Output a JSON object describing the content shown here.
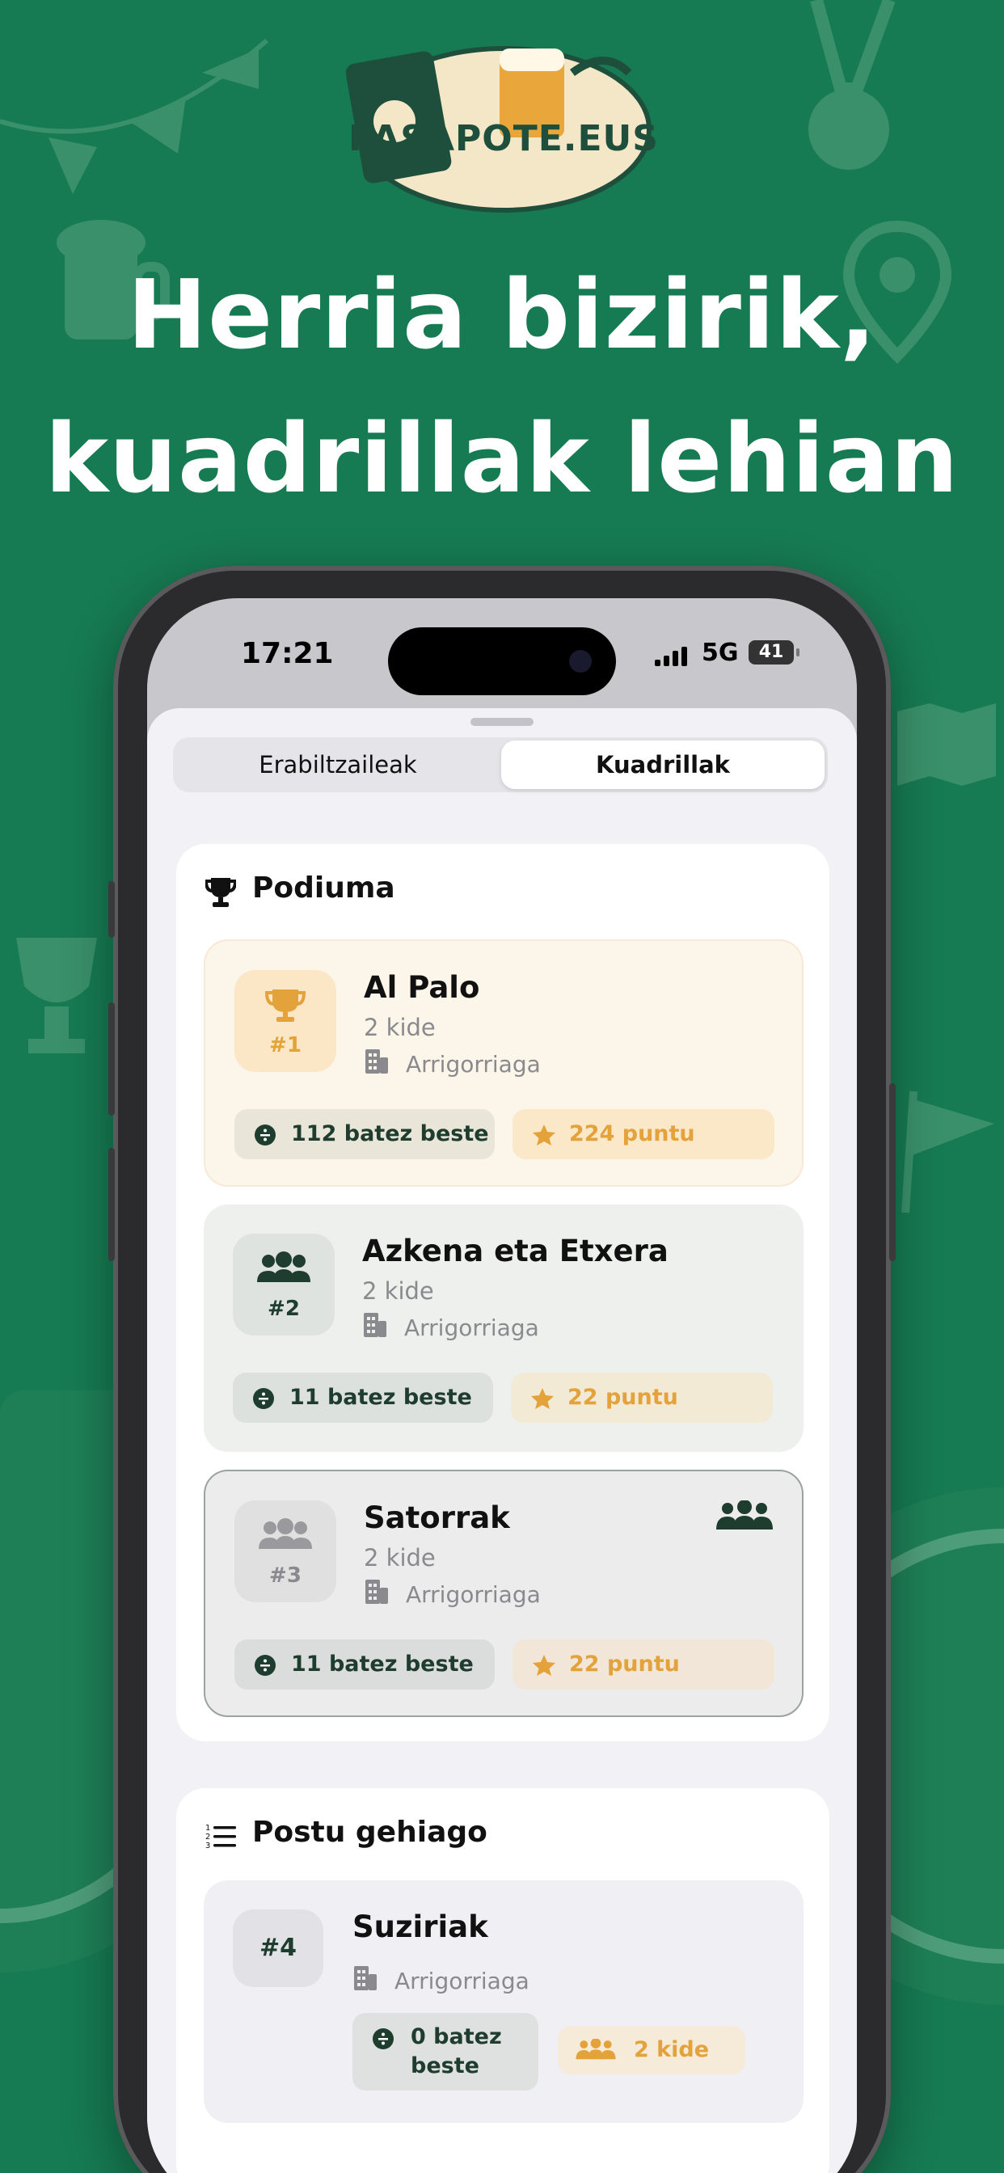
{
  "headline": {
    "line1": "Herria bizirik,",
    "line2": "kuadrillak lehian"
  },
  "logo": {
    "text": "PASAPOTE.EUS"
  },
  "status_bar": {
    "time": "17:21",
    "network": "5G",
    "battery": "41"
  },
  "tabs": [
    {
      "label": "Erabiltzaileak",
      "active": false
    },
    {
      "label": "Kuadrillak",
      "active": true
    }
  ],
  "podium": {
    "title": "Podiuma",
    "entries": [
      {
        "rank": "#1",
        "name": "Al Palo",
        "members": "2 kide",
        "town": "Arrigorriaga",
        "stat": "112 batez beste",
        "points": "224 puntu",
        "icon": "trophy-icon"
      },
      {
        "rank": "#2",
        "name": "Azkena eta Etxera",
        "members": "2 kide",
        "town": "Arrigorriaga",
        "stat": "11 batez beste",
        "points": "22 puntu",
        "icon": "group-icon"
      },
      {
        "rank": "#3",
        "name": "Satorrak",
        "members": "2 kide",
        "town": "Arrigorriaga",
        "stat": "11 batez beste",
        "points": "22 puntu",
        "icon": "group-icon"
      }
    ]
  },
  "more": {
    "title": "Postu gehiago",
    "entries": [
      {
        "rank": "#4",
        "name": "Suziriak",
        "town": "Arrigorriaga",
        "stat_line1": "0 batez",
        "stat_line2": "beste",
        "members": "2 kide"
      }
    ]
  },
  "colors": {
    "background": "#167a52",
    "gold": "#e3a23a",
    "dark_green": "#1f3d2f",
    "first_bg": "#fcf5ea",
    "second_bg": "#eef0ee",
    "third_bg": "#ececec"
  }
}
